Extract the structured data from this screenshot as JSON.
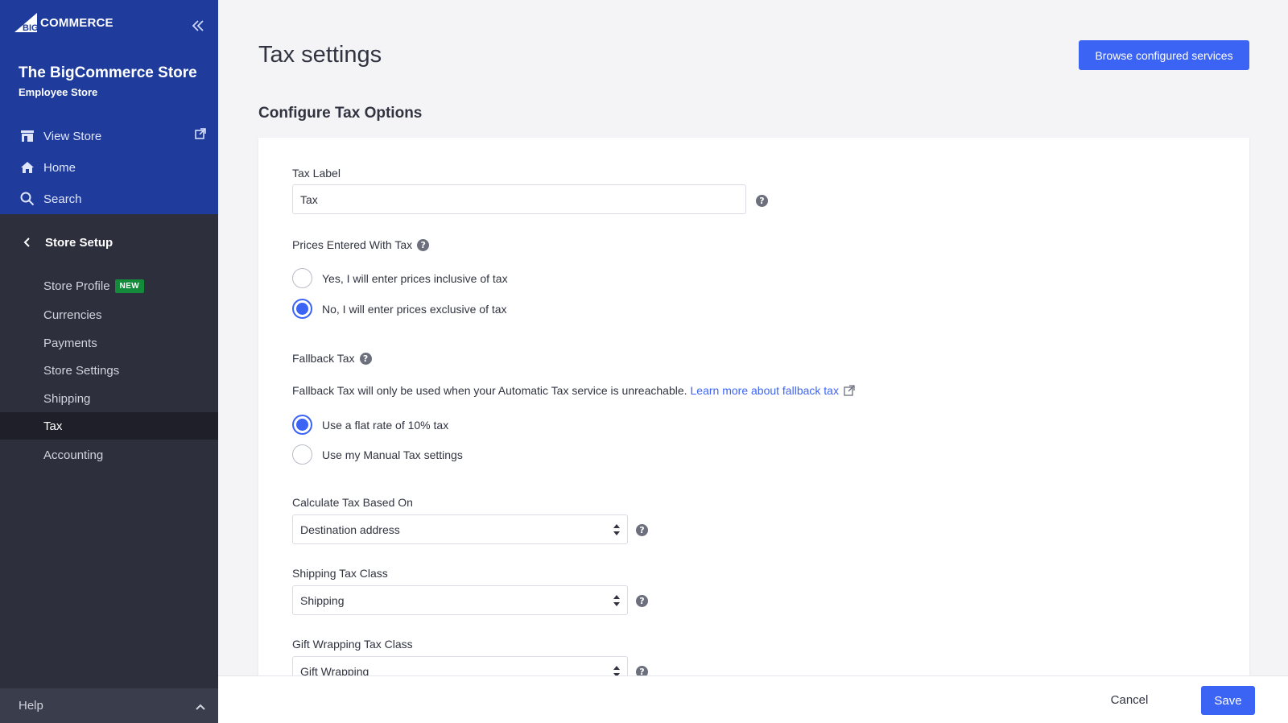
{
  "brand": {
    "logo_text": "COMMERCE",
    "logo_prefix": "BIG"
  },
  "store": {
    "name": "The BigCommerce Store",
    "subtitle": "Employee Store"
  },
  "top_nav": [
    {
      "label": "View Store",
      "icon": "storefront-icon"
    },
    {
      "label": "Home",
      "icon": "home-icon"
    },
    {
      "label": "Search",
      "icon": "search-icon"
    }
  ],
  "section": {
    "title": "Store Setup"
  },
  "nav": [
    {
      "label": "Store Profile",
      "badge": "NEW"
    },
    {
      "label": "Currencies"
    },
    {
      "label": "Payments"
    },
    {
      "label": "Store Settings"
    },
    {
      "label": "Shipping"
    },
    {
      "label": "Tax",
      "active": true
    },
    {
      "label": "Accounting"
    }
  ],
  "help": {
    "label": "Help"
  },
  "page": {
    "title": "Tax settings",
    "browse_button": "Browse configured services",
    "section_heading": "Configure Tax Options"
  },
  "form": {
    "tax_label": {
      "label": "Tax Label",
      "value": "Tax"
    },
    "prices_entered": {
      "label": "Prices Entered With Tax",
      "options": [
        {
          "label": "Yes, I will enter prices inclusive of tax",
          "checked": false
        },
        {
          "label": "No, I will enter prices exclusive of tax",
          "checked": true
        }
      ]
    },
    "fallback": {
      "label": "Fallback Tax",
      "description": "Fallback Tax will only be used when your Automatic Tax service is unreachable.",
      "link": "Learn more about fallback tax",
      "options": [
        {
          "label": "Use a flat rate of 10% tax",
          "checked": true
        },
        {
          "label": "Use my Manual Tax settings",
          "checked": false
        }
      ]
    },
    "calculate_based_on": {
      "label": "Calculate Tax Based On",
      "value": "Destination address"
    },
    "shipping_tax_class": {
      "label": "Shipping Tax Class",
      "value": "Shipping"
    },
    "gift_wrapping_tax_class": {
      "label": "Gift Wrapping Tax Class",
      "value": "Gift Wrapping"
    }
  },
  "footer": {
    "cancel": "Cancel",
    "save": "Save"
  },
  "colors": {
    "sidebar_top": "#1f3c9c",
    "sidebar": "#2d2f3c",
    "accent": "#3c64f4",
    "badge": "#148a3b"
  }
}
